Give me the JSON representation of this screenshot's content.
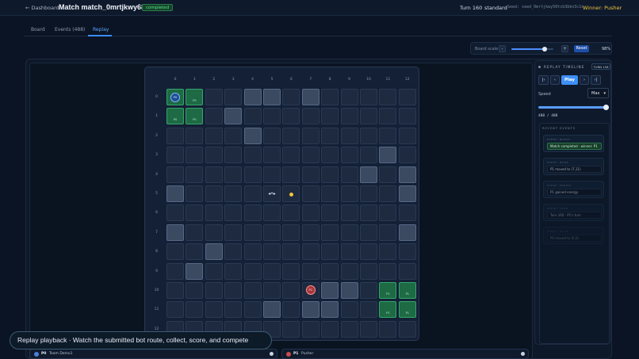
{
  "header": {
    "back_label": "← Dashboard",
    "title": "Match match_0mrtjkwy68...",
    "status_badge": "completed",
    "turn": "Turn 160",
    "mode": "standard",
    "seed": "Seed: seed_0mrtjkwy50tcb3bkn3c1n",
    "winner": "Winner: Pusher"
  },
  "tabs": [
    {
      "label": "Board"
    },
    {
      "label": "Events (488)"
    },
    {
      "label": "Replay"
    }
  ],
  "active_tab": "Replay",
  "board_scale": {
    "label": "Board scale",
    "minus": "-",
    "plus": "+",
    "reset": "Reset",
    "percent": "98%",
    "value_fraction": 0.8
  },
  "board": {
    "columns": [
      "0",
      "1",
      "2",
      "3",
      "4",
      "5",
      "6",
      "7",
      "8",
      "9",
      "10",
      "11",
      "12"
    ],
    "rows": [
      "0",
      "1",
      "2",
      "3",
      "4",
      "5",
      "6",
      "7",
      "8",
      "9",
      "10",
      "11",
      "12"
    ],
    "owner_p0_label": "P0",
    "owner_p1_label": "P1",
    "p0_label": "P0",
    "p1_label": "P1",
    "robot_glyph": "◂•▸",
    "p0_cells": [
      [
        0,
        0
      ],
      [
        0,
        1
      ],
      [
        1,
        0
      ],
      [
        1,
        1
      ]
    ],
    "p1_cells": [
      [
        10,
        11
      ],
      [
        10,
        12
      ],
      [
        11,
        11
      ],
      [
        11,
        12
      ]
    ],
    "walls": [
      [
        0,
        4
      ],
      [
        0,
        5
      ],
      [
        0,
        7
      ],
      [
        1,
        3
      ],
      [
        2,
        4
      ],
      [
        3,
        11
      ],
      [
        4,
        10
      ],
      [
        4,
        12
      ],
      [
        5,
        0
      ],
      [
        5,
        12
      ],
      [
        7,
        0
      ],
      [
        7,
        12
      ],
      [
        8,
        2
      ],
      [
        9,
        1
      ],
      [
        10,
        8
      ],
      [
        10,
        9
      ],
      [
        11,
        5
      ],
      [
        11,
        7
      ],
      [
        11,
        8
      ]
    ],
    "p0_pos": [
      0,
      0
    ],
    "p1_pos": [
      10,
      7
    ],
    "robot_pos": [
      5,
      5
    ],
    "coin_pos": [
      5,
      6
    ]
  },
  "timeline": {
    "title": "REPLAY TIMELINE",
    "turn_badge": "TURN 158",
    "first": "|‹",
    "prev": "‹",
    "play": "Play",
    "next": "›",
    "last": "›|",
    "speed_label": "Speed",
    "speed_value": "Max",
    "progress": "488 / 488",
    "progress_fraction": 1.0
  },
  "recent_events": {
    "title": "RECENT EVENTS",
    "items": [
      {
        "kind": "EVENT: MATCH",
        "message": "Match completed - winner: P1"
      },
      {
        "kind": "EVENT: MOVE",
        "message": "P1 moved to (7,11)"
      },
      {
        "kind": "EVENT: ENERGY",
        "message": "P1 gained energy"
      },
      {
        "kind": "EVENT: TURN",
        "message": "Turn 160 · P1's turn"
      },
      {
        "kind": "EVENT: MOVE",
        "message": "P0 moved to (0,0)"
      }
    ]
  },
  "toast": "Replay playback · Watch the submitted bot route, collect, score, and compete",
  "players": [
    {
      "id": "P0",
      "name": "Team Demo1",
      "color": "#4a7fd6"
    },
    {
      "id": "P1",
      "name": "Pusher",
      "color": "#c94b4b"
    }
  ]
}
